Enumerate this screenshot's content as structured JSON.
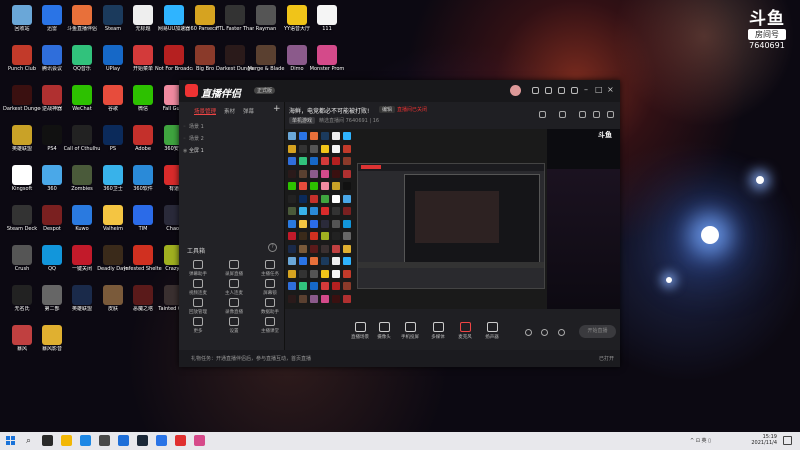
{
  "watermark": {
    "logo": "斗鱼",
    "sub": "房间号",
    "room_number": "7640691"
  },
  "desktop_icons": [
    {
      "label": "回收站",
      "color": "#6aa7d8"
    },
    {
      "label": "迅雷",
      "color": "#2a74e6"
    },
    {
      "label": "斗鱼直播伴侣",
      "color": "#e8703a"
    },
    {
      "label": "Steam",
      "color": "#1b3a5c"
    },
    {
      "label": "无标题",
      "color": "#eeeeee"
    },
    {
      "label": "网易UU加速器",
      "color": "#2fb4ff"
    },
    {
      "label": "60 Parsecs!",
      "color": "#d6a320"
    },
    {
      "label": "FTL Faster Than Light",
      "color": "#333333"
    },
    {
      "label": "Rayman",
      "color": "#555555"
    },
    {
      "label": "YY语音大厅",
      "color": "#f0c419"
    },
    {
      "label": "111",
      "color": "#f5f5f5"
    },
    {
      "label": "Punch Club",
      "color": "#c23a2a"
    },
    {
      "label": "腾讯会议",
      "color": "#2f6edb"
    },
    {
      "label": "QQ音乐",
      "color": "#31c27c"
    },
    {
      "label": "UPlay",
      "color": "#1668c7"
    },
    {
      "label": "开始菜单",
      "color": "#d33a3a"
    },
    {
      "label": "Not For Broadcast",
      "color": "#b52020"
    },
    {
      "label": "Big Bro",
      "color": "#8a3a2a"
    },
    {
      "label": "Darkest Dungeon",
      "color": "#2a1a1a"
    },
    {
      "label": "Merge & Blade",
      "color": "#5a4030"
    },
    {
      "label": "Dimo",
      "color": "#8b5a8b"
    },
    {
      "label": "Monster Prom",
      "color": "#d44a8a"
    },
    {
      "label": "Darkest Dungeon",
      "color": "#3a1010"
    },
    {
      "label": "逆战神器",
      "color": "#b03030"
    },
    {
      "label": "WeChat",
      "color": "#2dc100"
    },
    {
      "label": "谷歌",
      "color": "#e74c3c"
    },
    {
      "label": "微信",
      "color": "#2dc100"
    },
    {
      "label": "Fall Guys",
      "color": "#f08aa0"
    },
    {
      "label": "英雄联盟",
      "color": "#c9a227"
    },
    {
      "label": "PS4",
      "color": "#111111"
    },
    {
      "label": "Call of Cthulhu",
      "color": "#222222"
    },
    {
      "label": "PS",
      "color": "#0b2a5a"
    },
    {
      "label": "Adobe",
      "color": "#c4302b"
    },
    {
      "label": "360安全",
      "color": "#3fa43f"
    },
    {
      "label": "Kingsoft",
      "color": "#ffffff"
    },
    {
      "label": "360",
      "color": "#4aa8e8"
    },
    {
      "label": "Zombies",
      "color": "#4a5a3a"
    },
    {
      "label": "360卫士",
      "color": "#38b2ea"
    },
    {
      "label": "360软件",
      "color": "#2a8ad8"
    },
    {
      "label": "有道",
      "color": "#d92b2b"
    },
    {
      "label": "Steam Deck",
      "color": "#333333"
    },
    {
      "label": "Despot",
      "color": "#7a2020"
    },
    {
      "label": "Kuwo",
      "color": "#2a7ae0"
    },
    {
      "label": "Valheim",
      "color": "#f4c542"
    },
    {
      "label": "TIM",
      "color": "#2b6be8"
    },
    {
      "label": "Chaos",
      "color": "#2a2a3a"
    },
    {
      "label": "Crush",
      "color": "#555555"
    },
    {
      "label": "QQ",
      "color": "#1296db"
    },
    {
      "label": "一键关闭",
      "color": "#c21a2a"
    },
    {
      "label": "Deadly Days",
      "color": "#3a2a1a"
    },
    {
      "label": "Infested Shelter",
      "color": "#d03020"
    },
    {
      "label": "CrazyK",
      "color": "#a0b020"
    },
    {
      "label": "无名氏",
      "color": "#222222"
    },
    {
      "label": "第二部",
      "color": "#666666"
    },
    {
      "label": "英雄联盟",
      "color": "#1a2a4a"
    },
    {
      "label": "皮肤",
      "color": "#7a5a3a"
    },
    {
      "label": "恶魔之塔",
      "color": "#5a1a1a"
    },
    {
      "label": "Tainted Grail",
      "color": "#3a3030"
    },
    {
      "label": "暴风",
      "color": "#c04040"
    },
    {
      "label": "暴风影音",
      "color": "#e0b030"
    }
  ],
  "app": {
    "name": "直播伴侣",
    "badge": "正式版",
    "tabs": [
      "场景管理",
      "素材",
      "弹幕"
    ],
    "scenes": [
      "场景 1",
      "场景 2",
      "全屏 1"
    ],
    "room": {
      "title": "海鲜，电竞都必不可能被打败!",
      "edit_label": "编辑",
      "status": "直播间已关闭",
      "tag": "单机游戏",
      "info": "精选直播间  7640691  | 16"
    },
    "tools": {
      "title": "工具箱",
      "items": [
        {
          "label": "弹幕助手"
        },
        {
          "label": "录屏直播"
        },
        {
          "label": "主播任务"
        },
        {
          "label": "视频连麦"
        },
        {
          "label": "主人连麦"
        },
        {
          "label": "屏幕锁"
        },
        {
          "label": "回放管理"
        },
        {
          "label": "录像直播"
        },
        {
          "label": "数据助手"
        },
        {
          "label": "更多"
        },
        {
          "label": "设置"
        },
        {
          "label": "主播课堂"
        }
      ]
    },
    "controls": [
      {
        "label": "直播场景"
      },
      {
        "label": "摄像头"
      },
      {
        "label": "手机投屏"
      },
      {
        "label": "多媒体"
      },
      {
        "label": "麦克风"
      },
      {
        "label": "扬声器"
      }
    ],
    "start_label": "开始直播",
    "footer_text": "礼物任务：开通直播伴侣后，参与直播互动，首页直播",
    "footer_right": "已打开"
  },
  "taskbar": {
    "apps": [
      {
        "color": "#2a2a2a"
      },
      {
        "color": "#f2b705"
      },
      {
        "color": "#1e88e5"
      },
      {
        "color": "#4a4a4a"
      },
      {
        "color": "#1f6fd8"
      },
      {
        "color": "#1b2838"
      },
      {
        "color": "#2a74e6"
      },
      {
        "color": "#e03030"
      },
      {
        "color": "#d64a8a"
      }
    ],
    "search_icon": "search-icon",
    "tray": "^  ⊡  英  ▯",
    "time": "15:19",
    "date": "2021/11/4"
  },
  "colors": {
    "accent": "#e44444",
    "app_bg": "#1f1f23",
    "taskbar": "#e8e8ec"
  }
}
